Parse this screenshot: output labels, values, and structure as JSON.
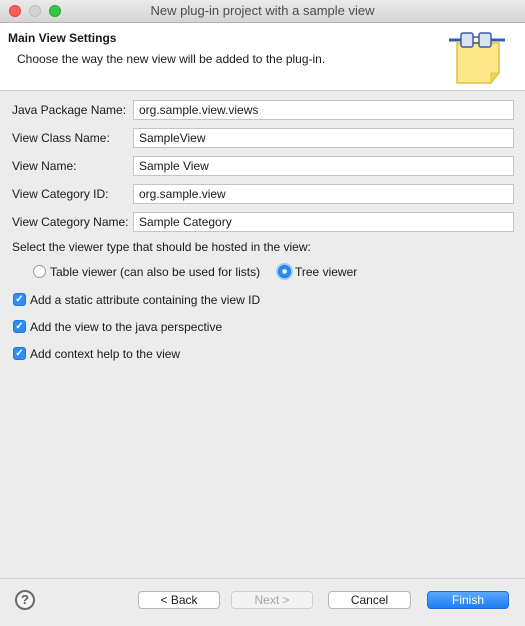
{
  "window": {
    "title": "New plug-in project with a sample view"
  },
  "header": {
    "title": "Main View Settings",
    "description": "Choose the way the new view will be added to the plug-in.",
    "icon": "plugin-wizard-icon"
  },
  "fields": [
    {
      "label": "Java Package Name:",
      "value": "org.sample.view.views"
    },
    {
      "label": "View Class Name:",
      "value": "SampleView"
    },
    {
      "label": "View Name:",
      "value": "Sample View"
    },
    {
      "label": "View Category ID:",
      "value": "org.sample.view"
    },
    {
      "label": "View Category Name:",
      "value": "Sample Category"
    }
  ],
  "viewer": {
    "prompt": "Select the viewer type that should be hosted in the view:",
    "options": [
      {
        "label": "Table viewer (can also be used for lists)",
        "selected": false
      },
      {
        "label": "Tree viewer",
        "selected": true
      }
    ]
  },
  "checkboxes": [
    {
      "label": "Add a static attribute containing the view ID",
      "checked": true
    },
    {
      "label": "Add the view to the java perspective",
      "checked": true
    },
    {
      "label": "Add context help to the view",
      "checked": true
    }
  ],
  "footer": {
    "help_icon": "?",
    "back": "< Back",
    "next": "Next >",
    "cancel": "Cancel",
    "finish": "Finish"
  },
  "colors": {
    "accent": "#2f8ef5",
    "close": "#fc5f57",
    "maximize": "#34c84a"
  }
}
